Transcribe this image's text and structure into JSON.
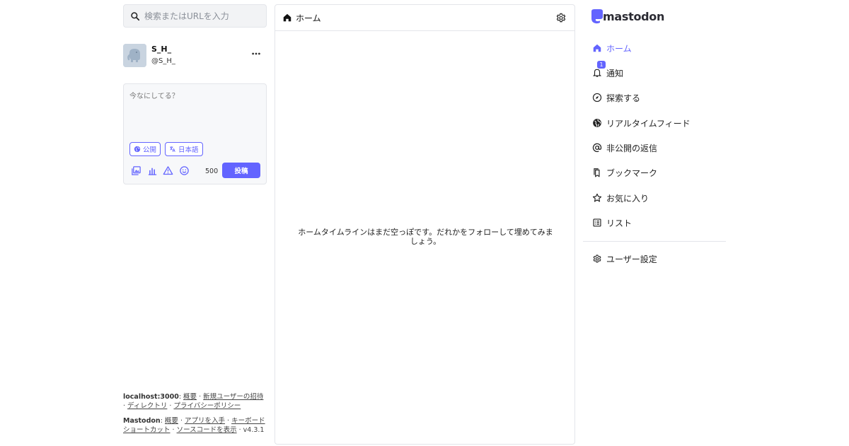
{
  "search": {
    "placeholder": "検索またはURLを入力"
  },
  "profile": {
    "display_name": "S_H_",
    "acct": "@S_H_"
  },
  "composer": {
    "placeholder": "今なにしてる？",
    "visibility_label": "公開",
    "language_label": "日本語",
    "char_count": "500",
    "post_label": "投稿"
  },
  "footer": {
    "server": {
      "name": "localhost:3000",
      "links": [
        "概要",
        "新規ユーザーの招待",
        "ディレクトリ",
        "プライバシーポリシー"
      ]
    },
    "mastodon": {
      "name": "Mastodon",
      "links": [
        "概要",
        "アプリを入手",
        "キーボードショートカット",
        "ソースコードを表示"
      ],
      "version": "v4.3.1"
    }
  },
  "column": {
    "title": "ホーム",
    "empty_message": "ホームタイムラインはまだ空っぽです。だれかをフォローして埋めてみましょう。"
  },
  "nav": {
    "logo_text": "mastodon",
    "items": [
      {
        "label": "ホーム",
        "icon": "home-icon"
      },
      {
        "label": "通知",
        "icon": "bell-icon",
        "badge": "1"
      },
      {
        "label": "探索する",
        "icon": "compass-icon"
      },
      {
        "label": "リアルタイムフィード",
        "icon": "globe-icon"
      },
      {
        "label": "非公開の返信",
        "icon": "at-icon"
      },
      {
        "label": "ブックマーク",
        "icon": "bookmark-icon"
      },
      {
        "label": "お気に入り",
        "icon": "star-icon"
      },
      {
        "label": "リスト",
        "icon": "list-icon"
      }
    ],
    "settings_label": "ユーザー設定"
  },
  "colors": {
    "accent": "#6364ff",
    "border": "#e3e5ea",
    "text": "#222222"
  }
}
